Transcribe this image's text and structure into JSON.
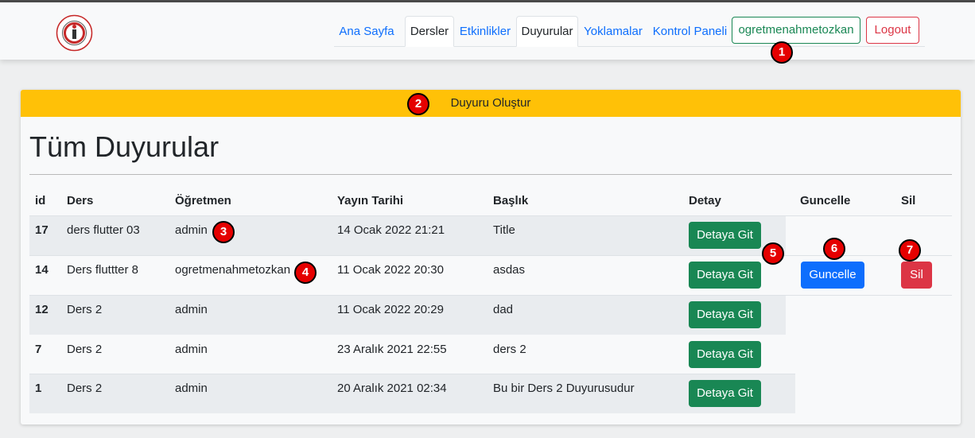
{
  "navbar": {
    "logo_icon": "university-logo-icon",
    "links": [
      {
        "label": "Ana Sayfa",
        "active": false
      },
      {
        "label": "Dersler",
        "active": true
      },
      {
        "label": "Etkinlikler",
        "active": false
      },
      {
        "label": "Duyurular",
        "active": true
      },
      {
        "label": "Yoklamalar",
        "active": false
      },
      {
        "label": "Kontrol Paneli",
        "active": false
      }
    ],
    "user_button": "ogretmenahmetozkan",
    "logout_button": "Logout"
  },
  "markers": [
    "1",
    "2",
    "3",
    "4",
    "5",
    "6",
    "7"
  ],
  "card": {
    "header_button": "Duyuru Oluştur",
    "title": "Tüm Duyurular"
  },
  "table": {
    "headers": [
      "id",
      "Ders",
      "Öğretmen",
      "Yayın Tarihi",
      "Başlık",
      "Detay",
      "Guncelle",
      "Sil"
    ],
    "rows": [
      {
        "id": "17",
        "ders": "ders flutter 03",
        "ogretmen": "admin",
        "tarih": "14 Ocak 2022 21:21",
        "baslik": "Title",
        "detay": "Detaya Git"
      },
      {
        "id": "14",
        "ders": "Ders fluttter 8",
        "ogretmen": "ogretmenahmetozkan",
        "tarih": "11 Ocak 2022 20:30",
        "baslik": "asdas",
        "detay": "Detaya Git",
        "guncelle": "Guncelle",
        "sil": "Sil"
      },
      {
        "id": "12",
        "ders": "Ders 2",
        "ogretmen": "admin",
        "tarih": "11 Ocak 2022 20:29",
        "baslik": "dad",
        "detay": "Detaya Git"
      },
      {
        "id": "7",
        "ders": "Ders 2",
        "ogretmen": "admin",
        "tarih": "23 Aralık 2021 22:55",
        "baslik": "ders 2",
        "detay": "Detaya Git"
      },
      {
        "id": "1",
        "ders": "Ders 2",
        "ogretmen": "admin",
        "tarih": "20 Aralık 2021 02:34",
        "baslik": "Bu bir Ders 2 Duyurusudur",
        "detay": "Detaya Git"
      }
    ]
  },
  "colors": {
    "primary": "#0d6efd",
    "success": "#198754",
    "danger": "#dc3545",
    "warning": "#ffc107",
    "marker": "#e50000"
  }
}
